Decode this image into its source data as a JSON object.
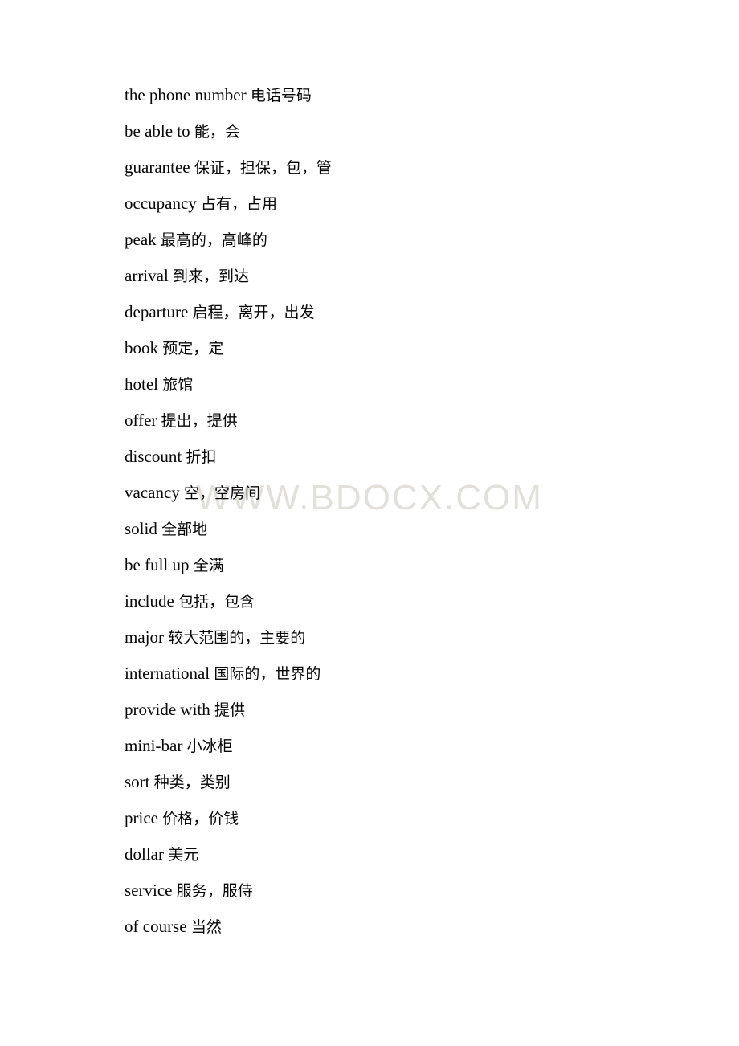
{
  "document": {
    "watermark": "WWW.BDOCX.COM",
    "lines": [
      {
        "en": "the phone number ",
        "zh": "电话号码"
      },
      {
        "en": "be able to ",
        "zh": "能，会"
      },
      {
        "en": "guarantee ",
        "zh": "保证，担保，包，管"
      },
      {
        "en": "occupancy ",
        "zh": "占有，占用"
      },
      {
        "en": "peak ",
        "zh": "最高的，高峰的"
      },
      {
        "en": "arrival ",
        "zh": "到来，到达"
      },
      {
        "en": "departure ",
        "zh": "启程，离开，出发"
      },
      {
        "en": "book ",
        "zh": "预定，定"
      },
      {
        "en": "hotel ",
        "zh": "旅馆"
      },
      {
        "en": "offer ",
        "zh": "提出，提供"
      },
      {
        "en": "discount ",
        "zh": "折扣"
      },
      {
        "en": "vacancy ",
        "zh": "空，空房间"
      },
      {
        "en": "solid ",
        "zh": "全部地"
      },
      {
        "en": "be full up ",
        "zh": "全满"
      },
      {
        "en": "include ",
        "zh": "包括，包含"
      },
      {
        "en": "major ",
        "zh": "较大范围的，主要的"
      },
      {
        "en": "international ",
        "zh": "国际的，世界的"
      },
      {
        "en": "provide with ",
        "zh": "提供"
      },
      {
        "en": "mini-bar ",
        "zh": "小冰柜"
      },
      {
        "en": "sort ",
        "zh": "种类，类别"
      },
      {
        "en": "price ",
        "zh": "价格，价钱"
      },
      {
        "en": "dollar ",
        "zh": "美元"
      },
      {
        "en": "service ",
        "zh": "服务，服侍"
      },
      {
        "en": "of course ",
        "zh": "当然"
      }
    ]
  }
}
